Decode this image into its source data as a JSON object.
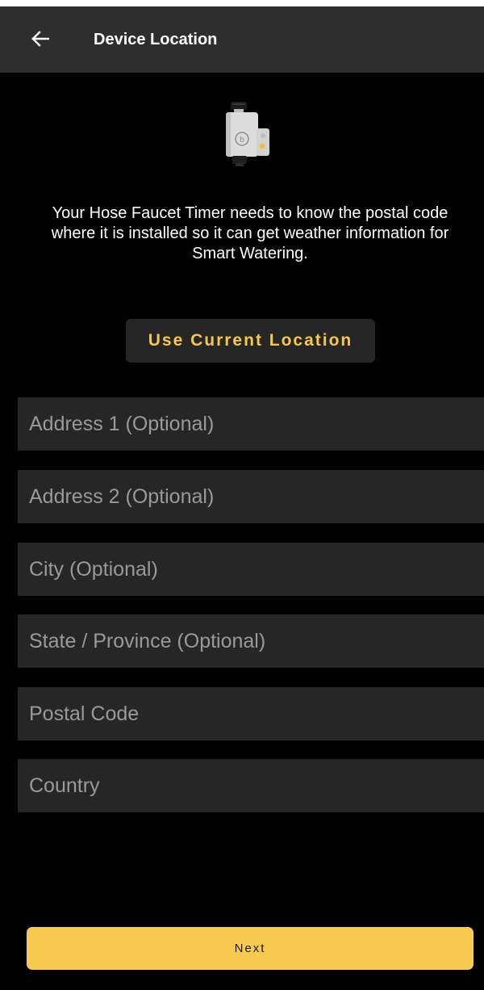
{
  "header": {
    "back_icon": "arrow-left-icon",
    "title": "Device Location"
  },
  "device": {
    "image_icon": "hose-faucet-timer-image",
    "logo_letter": "b"
  },
  "intro": {
    "text": "Your Hose Faucet Timer needs to know the postal code where it is installed so it can get weather information for Smart Watering."
  },
  "actions": {
    "use_current_location": "Use Current Location",
    "next": "Next"
  },
  "form": {
    "address1": {
      "placeholder": "Address 1 (Optional)",
      "value": ""
    },
    "address2": {
      "placeholder": "Address 2 (Optional)",
      "value": ""
    },
    "city": {
      "placeholder": "City (Optional)",
      "value": ""
    },
    "state": {
      "placeholder": "State / Province (Optional)",
      "value": ""
    },
    "postal_code": {
      "placeholder": "Postal Code",
      "value": ""
    },
    "country": {
      "placeholder": "Country",
      "value": ""
    }
  },
  "colors": {
    "background": "#000000",
    "app_bar": "#2e2e2e",
    "field": "#262626",
    "accent": "#f7cb50",
    "accent_text": "#f5c84c",
    "placeholder": "#9a9a9a"
  }
}
